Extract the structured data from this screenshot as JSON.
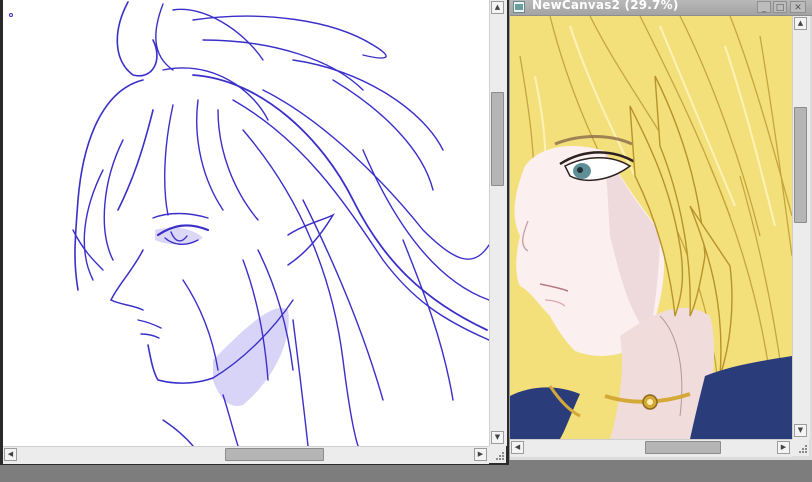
{
  "right_window": {
    "title": "NewCanvas2 (29.7%)",
    "buttons": {
      "minimize": "_",
      "maximize": "□",
      "close": "✕"
    }
  },
  "icons": {
    "scroll_up": "▲",
    "scroll_down": "▼",
    "scroll_left": "◀",
    "scroll_right": "▶",
    "resize_grip": "resize-grip-icon",
    "app_icon": "canvas-window-icon"
  },
  "colors": {
    "sketch_line": "#3a2fc9",
    "sketch_shade": "#b7b0f0",
    "hair": "#f0d560",
    "hair_shadow": "#b8922a",
    "skin": "#fbeff0",
    "eye": "#5f8f96",
    "jacket": "#2a3c7a",
    "gold": "#d4a93a"
  }
}
